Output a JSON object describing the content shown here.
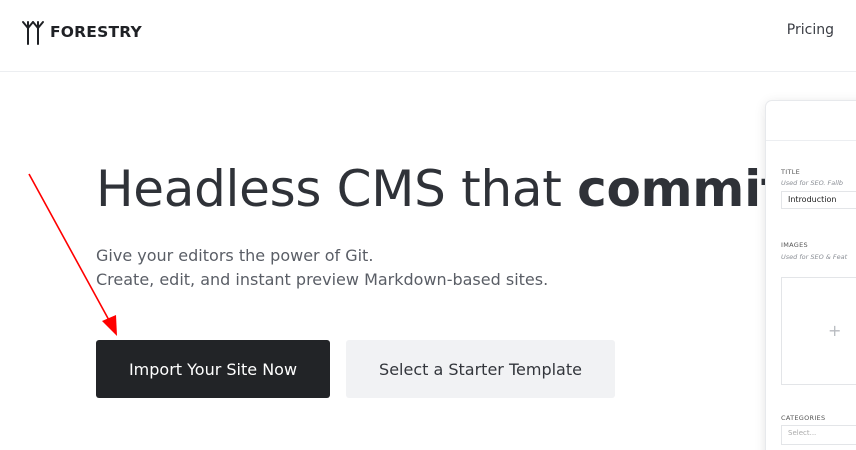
{
  "header": {
    "logo_text": "FORESTRY",
    "logo_icon": "forestry-tree-logo-icon",
    "nav": {
      "pricing_label": "Pricing"
    }
  },
  "hero": {
    "title_light": "Headless CMS that",
    "title_bold": "commits",
    "subtitle_line1": "Give your editors the power of Git.",
    "subtitle_line2": "Create, edit, and instant preview Markdown-based sites.",
    "primary_button": "Import Your Site Now",
    "secondary_button": "Select a Starter Template"
  },
  "preview": {
    "title_label": "TITLE",
    "title_hint": "Used for SEO. Fallb",
    "title_value": "Introduction",
    "images_label": "IMAGES",
    "images_hint": "Used for SEO & Feat",
    "add_icon": "+",
    "categories_label": "CATEGORIES",
    "categories_placeholder": "Select..."
  },
  "colors": {
    "primary_button_bg": "#222427",
    "secondary_button_bg": "#f1f2f4",
    "annotation_arrow": "#ff0000"
  }
}
